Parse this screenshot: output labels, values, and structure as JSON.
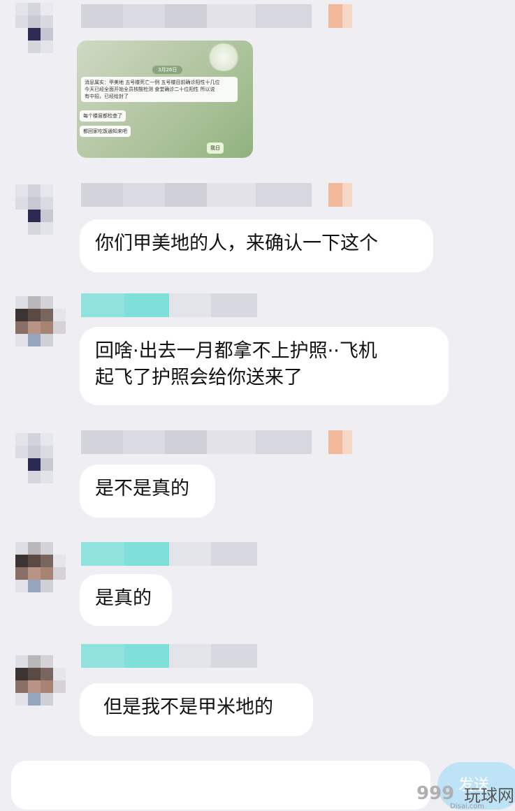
{
  "messages": [
    {
      "id": "m1",
      "sender": "other",
      "type": "image",
      "image": {
        "date": "3月26日",
        "lines": [
          "消息属实：甲美地 五号楼死亡一例 五号楼目前确诊阳性十几位",
          "今天已经全面开始全员核酸检测 食堂确诊二十位阳性 所以说",
          "有中招，已经给封了"
        ],
        "msg2": "每个楼层都检查了",
        "msg3": "都回家吃饭通知来吧",
        "reply": "我日"
      }
    },
    {
      "id": "m2",
      "sender": "other",
      "text": "你们甲美地的人，来确认一下这个"
    },
    {
      "id": "m3",
      "sender": "teal",
      "line1": "回啥·出去一月都拿不上护照··飞机",
      "line2": "起飞了护照会给你送来了"
    },
    {
      "id": "m4",
      "sender": "other",
      "text": "是不是真的"
    },
    {
      "id": "m5",
      "sender": "teal",
      "text": "是真的"
    },
    {
      "id": "m6",
      "sender": "teal",
      "text": "但是我不是甲米地的"
    }
  ],
  "composer": {
    "send_label": "发送"
  },
  "watermark": {
    "numerals": "999",
    "name": "玩球网",
    "site": "Disai.com"
  },
  "colors": {
    "background": "#eeeef3",
    "bubble": "#ffffff",
    "teal_name": "#7fe0da",
    "send": "#bfe3f6"
  }
}
